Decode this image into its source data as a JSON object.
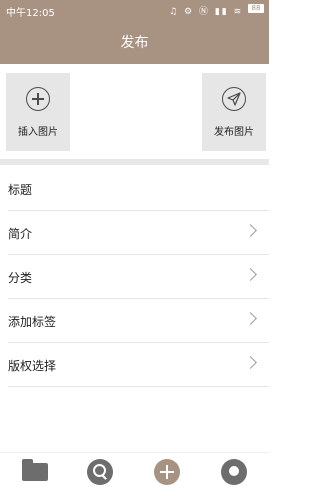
{
  "status_bar": {
    "time": "中午12:05",
    "icons": "♫ ⚙ Ⓝ ▮▮ ≋",
    "battery": "88"
  },
  "header": {
    "title": "发布"
  },
  "actions": {
    "insert_image_label": "插入图片",
    "publish_image_label": "发布图片"
  },
  "form_rows": [
    {
      "label": "标题",
      "has_chevron": false
    },
    {
      "label": "简介",
      "has_chevron": true
    },
    {
      "label": "分类",
      "has_chevron": true
    },
    {
      "label": "添加标签",
      "has_chevron": true
    },
    {
      "label": "版权选择",
      "has_chevron": true
    }
  ],
  "bottom_nav": {
    "items": [
      "folder-icon",
      "search-icon",
      "add-icon",
      "profile-icon"
    ],
    "accent_color": "#a89383"
  },
  "colors": {
    "header_bg": "#a89383",
    "icon_gray": "#6d6d6d"
  }
}
